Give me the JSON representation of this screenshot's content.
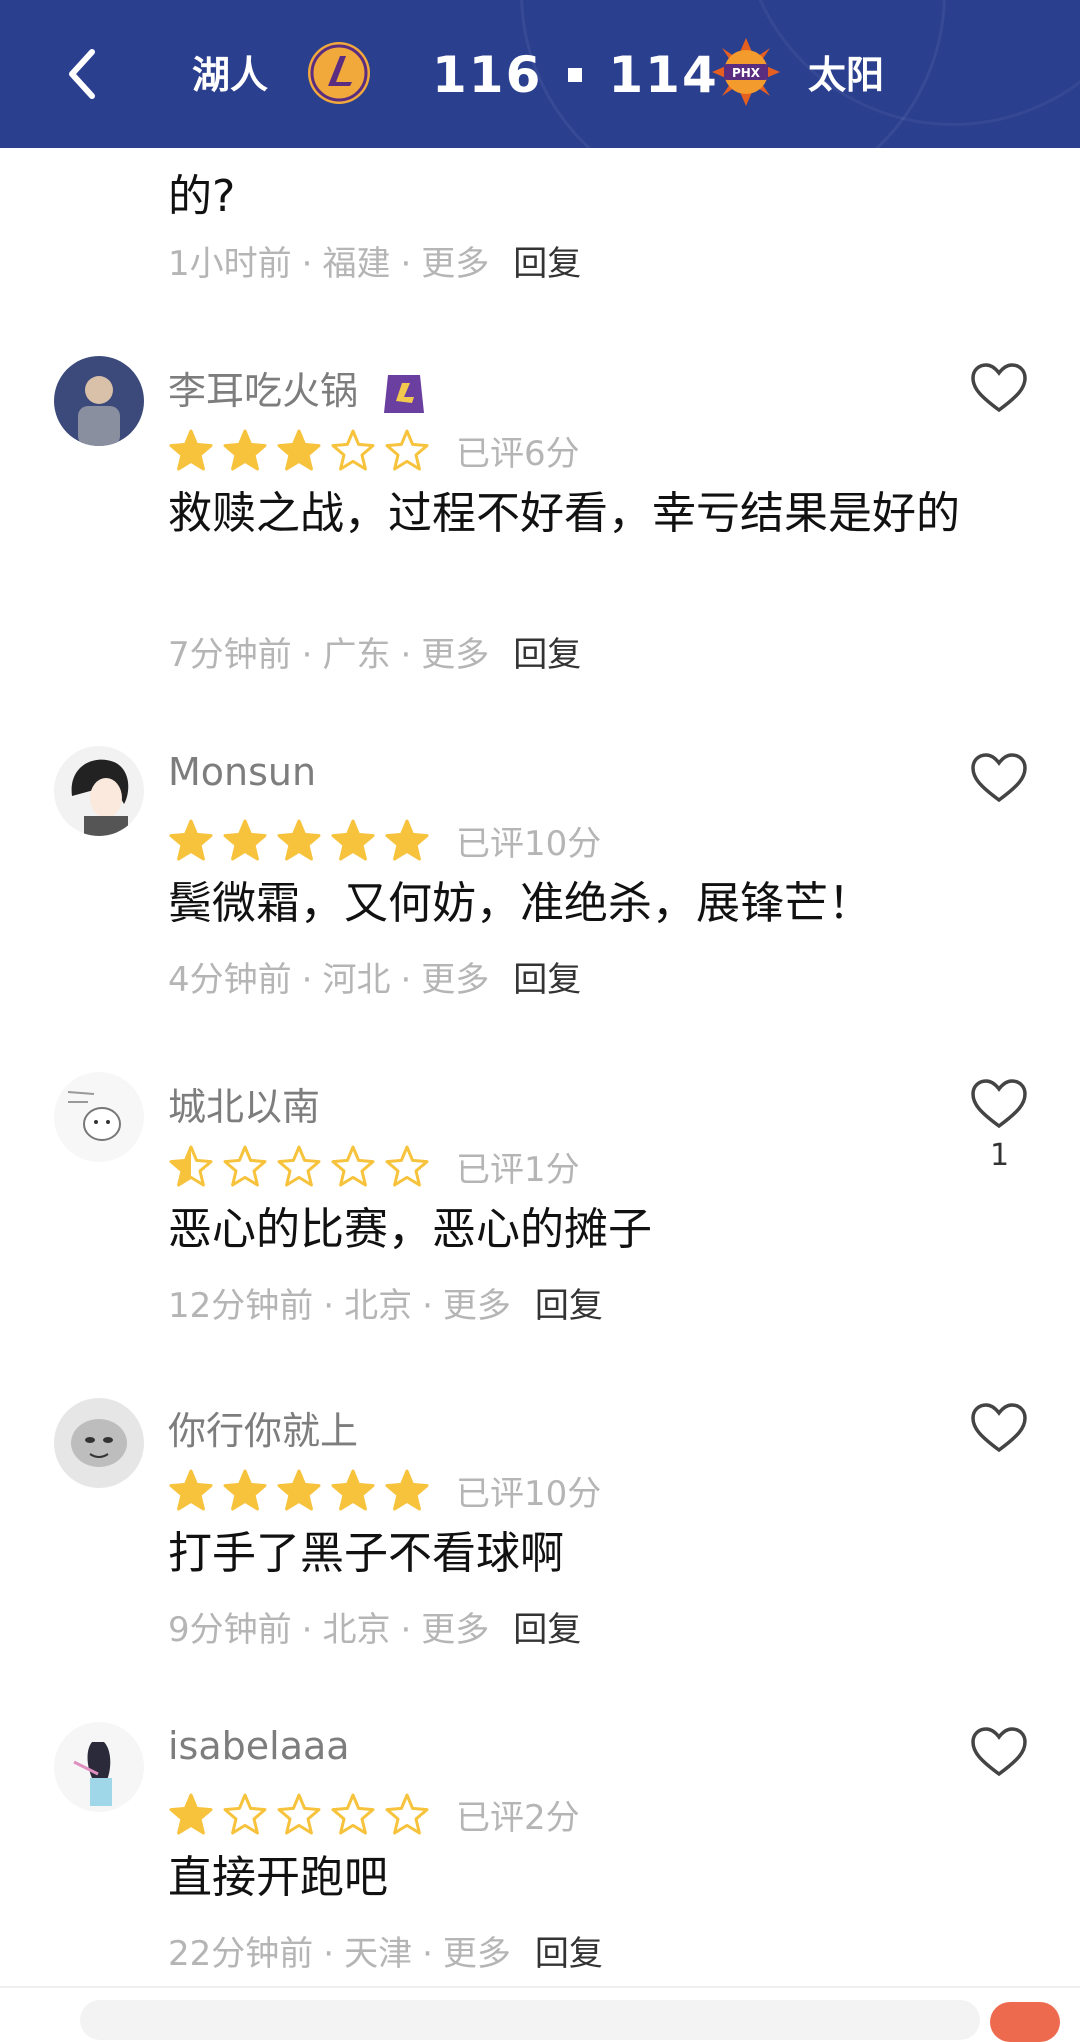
{
  "header": {
    "home_team": "湖人",
    "away_team": "太阳",
    "home_score": "116",
    "away_score": "114",
    "bg_color": "#2b3f8f"
  },
  "partial_comment": {
    "text": "的?",
    "time": "1小时前",
    "location": "福建",
    "more": "更多",
    "reply": "回复"
  },
  "comments": [
    {
      "username": "李耳吃火锅",
      "rating_stars": 3,
      "rating_text": "已评6分",
      "text": "救赎之战，过程不好看，幸亏结果是好的",
      "time": "7分钟前",
      "location": "广东",
      "more": "更多",
      "reply": "回复",
      "likes": ""
    },
    {
      "username": "Monsun",
      "rating_stars": 5,
      "rating_text": "已评10分",
      "text": "鬓微霜，又何妨，准绝杀，展锋芒！",
      "time": "4分钟前",
      "location": "河北",
      "more": "更多",
      "reply": "回复",
      "likes": ""
    },
    {
      "username": "城北以南",
      "rating_stars": 0.5,
      "rating_text": "已评1分",
      "text": "恶心的比赛，恶心的摊子",
      "time": "12分钟前",
      "location": "北京",
      "more": "更多",
      "reply": "回复",
      "likes": "1"
    },
    {
      "username": "你行你就上",
      "rating_stars": 5,
      "rating_text": "已评10分",
      "text": "打手了黑子不看球啊",
      "time": "9分钟前",
      "location": "北京",
      "more": "更多",
      "reply": "回复",
      "likes": ""
    },
    {
      "username": "isabelaaa",
      "rating_stars": 1,
      "rating_text": "已评2分",
      "text": "直接开跑吧",
      "time": "22分钟前",
      "location": "天津",
      "more": "更多",
      "reply": "回复",
      "likes": ""
    }
  ],
  "colors": {
    "star_fill": "#f7c33d",
    "muted_text": "#b5b5b5",
    "username": "#7d7d7d"
  }
}
